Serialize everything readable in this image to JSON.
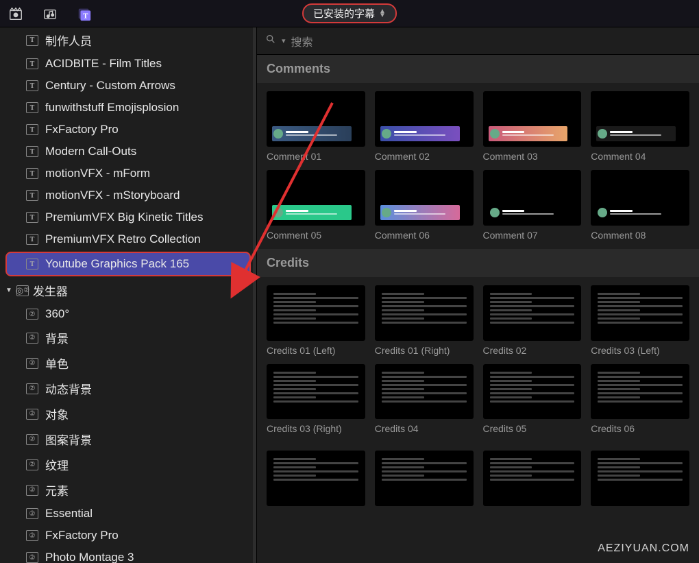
{
  "toolbar": {
    "filter_label": "已安装的字幕"
  },
  "search": {
    "placeholder": "搜索"
  },
  "sidebar": {
    "titles": [
      "制作人员",
      "ACIDBITE - Film Titles",
      "Century - Custom Arrows",
      "funwithstuff Emojisplosion",
      "FxFactory Pro",
      "Modern Call-Outs",
      "motionVFX - mForm",
      "motionVFX - mStoryboard",
      "PremiumVFX Big Kinetic Titles",
      "PremiumVFX Retro Collection",
      "Youtube Graphics Pack 165"
    ],
    "generators_header": "发生器",
    "generators": [
      "360°",
      "背景",
      "单色",
      "动态背景",
      "对象",
      "图案背景",
      "纹理",
      "元素",
      "Essential",
      "FxFactory Pro",
      "Photo Montage 3"
    ]
  },
  "sections": [
    {
      "name": "Comments",
      "items": [
        {
          "label": "Comment 01",
          "grad": [
            "#3b5a82",
            "#2a3f5a"
          ]
        },
        {
          "label": "Comment 02",
          "grad": [
            "#3a4fa8",
            "#7a4fbf"
          ]
        },
        {
          "label": "Comment 03",
          "grad": [
            "#c95a7a",
            "#e8a56a"
          ]
        },
        {
          "label": "Comment 04",
          "grad": [
            "#1a1a1a",
            "#1a1a1a"
          ]
        },
        {
          "label": "Comment 05",
          "grad": [
            "#2ac88a",
            "#2ac88a"
          ]
        },
        {
          "label": "Comment 06",
          "grad": [
            "#5a8fdc",
            "#d66a9a"
          ]
        },
        {
          "label": "Comment 07",
          "grad": [
            "#000",
            "#000"
          ]
        },
        {
          "label": "Comment 08",
          "grad": [
            "#000",
            "#000"
          ]
        }
      ]
    },
    {
      "name": "Credits",
      "items": [
        {
          "label": "Credits 01 (Left)"
        },
        {
          "label": "Credits 01 (Right)"
        },
        {
          "label": "Credits 02"
        },
        {
          "label": "Credits 03 (Left)"
        },
        {
          "label": "Credits 03 (Right)"
        },
        {
          "label": "Credits 04"
        },
        {
          "label": "Credits 05"
        },
        {
          "label": "Credits 06"
        }
      ]
    }
  ],
  "watermark": "AEZIYUAN.COM"
}
